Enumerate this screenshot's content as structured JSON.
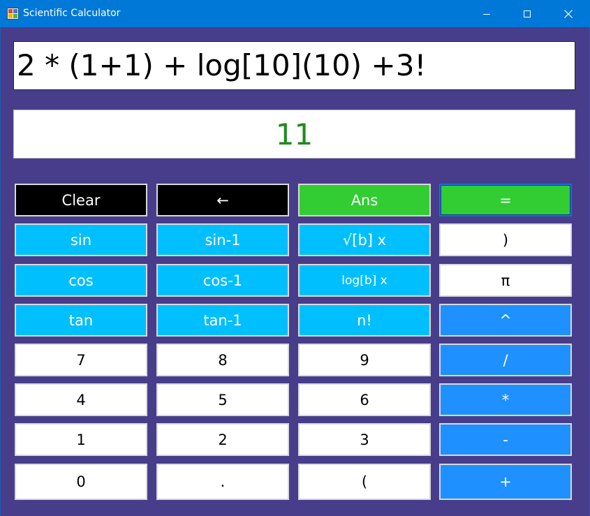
{
  "window": {
    "title": "Scientific Calculator",
    "icons": {
      "app": "calculator-app-icon",
      "minimize": "minimize-icon",
      "maximize": "maximize-icon",
      "close": "close-icon"
    }
  },
  "display": {
    "expression": "2 * (1+1) + log[10](10) +3!",
    "result": "11",
    "result_color": "#1f8a1f"
  },
  "buttons": {
    "clear": "Clear",
    "backspace": "←",
    "ans": "Ans",
    "equals": "=",
    "sin": "sin",
    "asin": "sin-1",
    "root": "√[b] x",
    "close_paren": ")",
    "cos": "cos",
    "acos": "cos-1",
    "log": "log[b] x",
    "pi": "π",
    "tan": "tan",
    "atan": "tan-1",
    "factorial": "n!",
    "power": "^",
    "d7": "7",
    "d8": "8",
    "d9": "9",
    "divide": "/",
    "d4": "4",
    "d5": "5",
    "d6": "6",
    "multiply": "*",
    "d1": "1",
    "d2": "2",
    "d3": "3",
    "minus": "-",
    "d0": "0",
    "dot": ".",
    "open_paren": "(",
    "plus": "+"
  },
  "colors": {
    "background": "#483D8B",
    "titlebar": "#0078D7",
    "function_buttons": "#00BFFF",
    "operator_buttons": "#1E90FF",
    "action_buttons": "#32CD32",
    "clear_buttons": "#000000"
  }
}
